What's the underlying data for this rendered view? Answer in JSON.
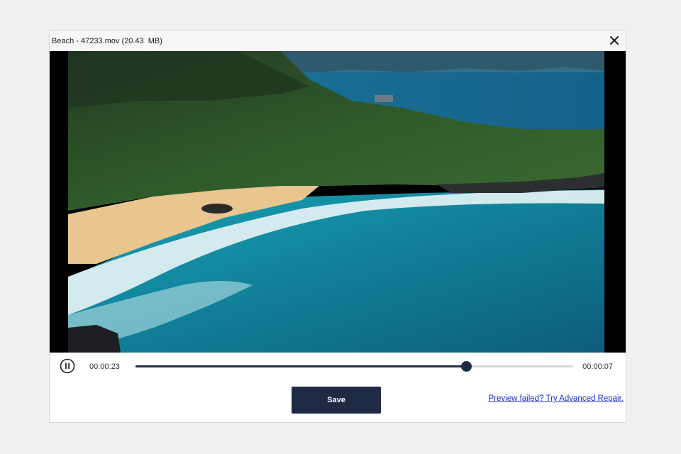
{
  "window": {
    "title": "Beach - 47233.mov (20.43  MB)",
    "close_icon": "close-icon"
  },
  "player": {
    "elapsed": "00:00:23",
    "remaining": "00:00:07",
    "progress": 0.756,
    "pause_icon": "pause-icon"
  },
  "actions": {
    "save_label": "Save",
    "repair_link": "Preview failed? Try Advanced Repair."
  },
  "colors": {
    "accent": "#1f2a44",
    "link": "#1a32c8",
    "track": "#d6d6d6"
  }
}
